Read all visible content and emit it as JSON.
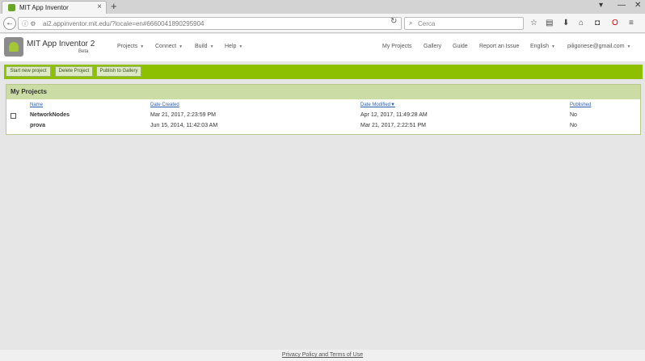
{
  "browser": {
    "tab_title": "MIT App Inventor",
    "url": "ai2.appinventor.mit.edu/?locale=en#6660041890295904",
    "search_placeholder": "Cerca"
  },
  "header": {
    "app_name": "MIT App Inventor 2",
    "app_sub": "Beta",
    "menu_left": [
      "Projects",
      "Connect",
      "Build",
      "Help"
    ],
    "menu_right": {
      "my_projects": "My Projects",
      "gallery": "Gallery",
      "guide": "Guide",
      "report": "Report an Issue",
      "language": "English",
      "user": "piligonese@gmail.com"
    }
  },
  "toolbar": {
    "start_new": "Start new project",
    "delete": "Delete Project",
    "publish": "Publish to Gallery"
  },
  "projects": {
    "title": "My Projects",
    "columns": [
      "Name",
      "Date Created",
      "Date Modified▼",
      "Published"
    ],
    "rows": [
      {
        "name": "NetworkNodes",
        "created": "Mar 21, 2017, 2:23:59 PM",
        "modified": "Apr 12, 2017, 11:49:28 AM",
        "published": "No"
      },
      {
        "name": "prova",
        "created": "Jun 15, 2014, 11:42:03 AM",
        "modified": "Mar 21, 2017, 2:22:51 PM",
        "published": "No"
      }
    ]
  },
  "footer": {
    "privacy": "Privacy Policy and Terms of Use"
  }
}
